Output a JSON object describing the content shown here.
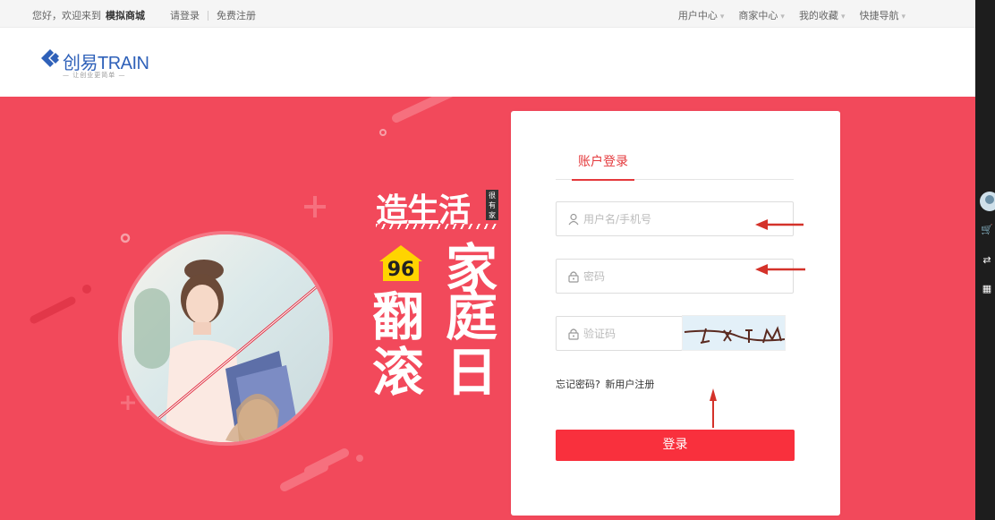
{
  "topbar": {
    "greeting": "您好，欢迎来到",
    "store_name": "模拟商城",
    "login_link": "请登录",
    "register_link": "免费注册",
    "menus": [
      "用户中心",
      "商家中心",
      "我的收藏",
      "快捷导航"
    ]
  },
  "header": {
    "logo_text": "创易TRAIN",
    "logo_slogan": "— 让创业更简单 —"
  },
  "banner": {
    "line1": "造生活",
    "tag": "很有家",
    "badge": "96",
    "big_chars": [
      "家",
      "翻",
      "庭",
      "滚",
      "日"
    ]
  },
  "login": {
    "tab_label": "账户登录",
    "username_placeholder": "用户名/手机号",
    "password_placeholder": "密码",
    "captcha_placeholder": "验证码",
    "forgot_label": "忘记密码?",
    "register_label": "新用户注册",
    "submit_label": "登录"
  },
  "colors": {
    "banner_bg": "#f2495b",
    "accent": "#e4393c",
    "button": "#f9303d"
  }
}
